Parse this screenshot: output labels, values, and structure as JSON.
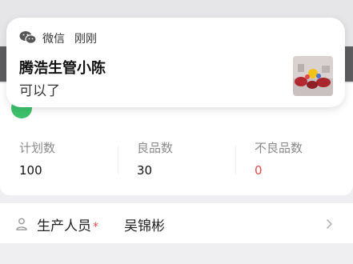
{
  "notification": {
    "app_name": "微信",
    "time": "刚刚",
    "sender": "腾浩生管小陈",
    "message": "可以了",
    "app_icon": "wechat-icon",
    "thumbnail": "photo-thumbnail"
  },
  "stats": [
    {
      "label": "计划数",
      "value": "100"
    },
    {
      "label": "良品数",
      "value": "30"
    },
    {
      "label": "不良品数",
      "value": "0"
    }
  ],
  "personnel": {
    "label": "生产人员",
    "required_mark": "*",
    "value": "吴锦彬",
    "icon": "person-icon",
    "chevron": "chevron-right-icon"
  },
  "colors": {
    "accent_green": "#3cc16b",
    "required_red": "#e04b4b"
  }
}
